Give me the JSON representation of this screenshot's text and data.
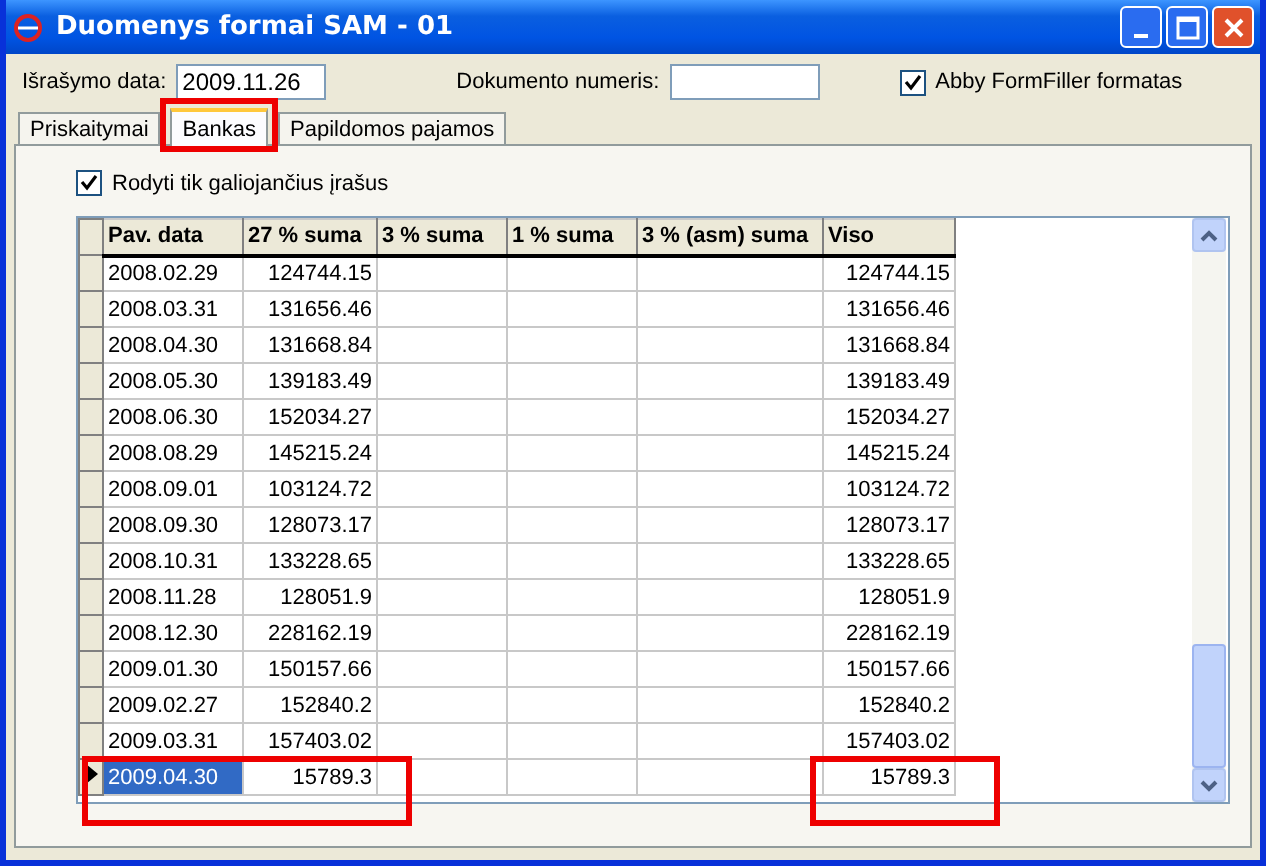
{
  "window": {
    "title": "Duomenys formai SAM - 01"
  },
  "header": {
    "date_label": "Išrašymo data:",
    "date_value": "2009.11.26",
    "doc_label": "Dokumento numeris:",
    "abby": {
      "label": "Abby FormFiller formatas",
      "checked": true
    }
  },
  "tabs": [
    {
      "label": "Priskaitymai",
      "selected": false,
      "highlighted": false
    },
    {
      "label": "Bankas",
      "selected": true,
      "highlighted": true
    },
    {
      "label": "Papildomos pajamos",
      "selected": false,
      "highlighted": false
    }
  ],
  "filter": {
    "label": "Rodyti tik galiojančius įrašus",
    "checked": true
  },
  "table": {
    "columns": [
      "Pav. data",
      "27 % suma",
      "3 % suma",
      "1 % suma",
      "3 % (asm) suma",
      "Viso"
    ],
    "rows": [
      {
        "cells": [
          "2008.02.29",
          "124744.15",
          "",
          "",
          "",
          "124744.15"
        ],
        "selected": false
      },
      {
        "cells": [
          "2008.03.31",
          "131656.46",
          "",
          "",
          "",
          "131656.46"
        ],
        "selected": false
      },
      {
        "cells": [
          "2008.04.30",
          "131668.84",
          "",
          "",
          "",
          "131668.84"
        ],
        "selected": false
      },
      {
        "cells": [
          "2008.05.30",
          "139183.49",
          "",
          "",
          "",
          "139183.49"
        ],
        "selected": false
      },
      {
        "cells": [
          "2008.06.30",
          "152034.27",
          "",
          "",
          "",
          "152034.27"
        ],
        "selected": false
      },
      {
        "cells": [
          "2008.08.29",
          "145215.24",
          "",
          "",
          "",
          "145215.24"
        ],
        "selected": false
      },
      {
        "cells": [
          "2008.09.01",
          "103124.72",
          "",
          "",
          "",
          "103124.72"
        ],
        "selected": false
      },
      {
        "cells": [
          "2008.09.30",
          "128073.17",
          "",
          "",
          "",
          "128073.17"
        ],
        "selected": false
      },
      {
        "cells": [
          "2008.10.31",
          "133228.65",
          "",
          "",
          "",
          "133228.65"
        ],
        "selected": false
      },
      {
        "cells": [
          "2008.11.28",
          "128051.9",
          "",
          "",
          "",
          "128051.9"
        ],
        "selected": false
      },
      {
        "cells": [
          "2008.12.30",
          "228162.19",
          "",
          "",
          "",
          "228162.19"
        ],
        "selected": false
      },
      {
        "cells": [
          "2009.01.30",
          "150157.66",
          "",
          "",
          "",
          "150157.66"
        ],
        "selected": false
      },
      {
        "cells": [
          "2009.02.27",
          "152840.2",
          "",
          "",
          "",
          "152840.2"
        ],
        "selected": false
      },
      {
        "cells": [
          "2009.03.31",
          "157403.02",
          "",
          "",
          "",
          "157403.02"
        ],
        "selected": false
      },
      {
        "cells": [
          "2009.04.30",
          "15789.3",
          "",
          "",
          "",
          "15789.3"
        ],
        "selected": true
      }
    ]
  }
}
